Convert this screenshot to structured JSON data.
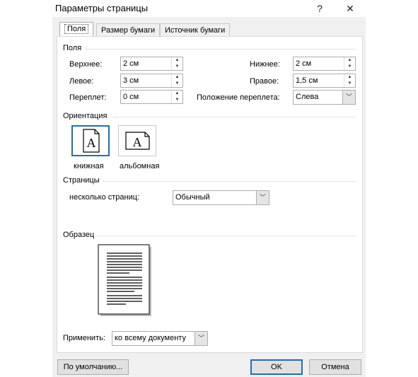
{
  "window": {
    "title": "Параметры страницы",
    "help_glyph": "?",
    "close_glyph": "✕"
  },
  "tabs": [
    {
      "label": "Поля",
      "active": true
    },
    {
      "label": "Размер бумаги",
      "active": false
    },
    {
      "label": "Источник бумаги",
      "active": false
    }
  ],
  "margins": {
    "section_label": "Поля",
    "top": {
      "label": "Верхнее:",
      "value": "2 см"
    },
    "bottom": {
      "label": "Нижнее:",
      "value": "2 см"
    },
    "left": {
      "label": "Левое:",
      "value": "3 см"
    },
    "right": {
      "label": "Правое:",
      "value": "1,5 см"
    },
    "gutter": {
      "label": "Переплет:",
      "value": "0 см"
    },
    "gutter_position": {
      "label": "Положение переплета:",
      "value": "Слева"
    }
  },
  "orientation": {
    "section_label": "Ориентация",
    "portrait": {
      "label": "книжная",
      "glyph": "A",
      "selected": true
    },
    "landscape": {
      "label": "альбомная",
      "glyph": "A",
      "selected": false
    }
  },
  "pages": {
    "section_label": "Страницы",
    "multiple_label": "несколько страниц:",
    "multiple_value": "Обычный"
  },
  "preview": {
    "section_label": "Образец"
  },
  "apply": {
    "label": "Применить:",
    "value": "ко всему документу"
  },
  "buttons": {
    "default_label": "По умолчанию...",
    "ok_label": "OK",
    "cancel_label": "Отмена"
  },
  "icons": {
    "spin_up": "▲",
    "spin_down": "▼",
    "dropdown": "﹀"
  },
  "colors": {
    "accent": "#1f6fb8",
    "dialog_bg": "#f0f0f0",
    "panel_bg": "#ffffff"
  }
}
